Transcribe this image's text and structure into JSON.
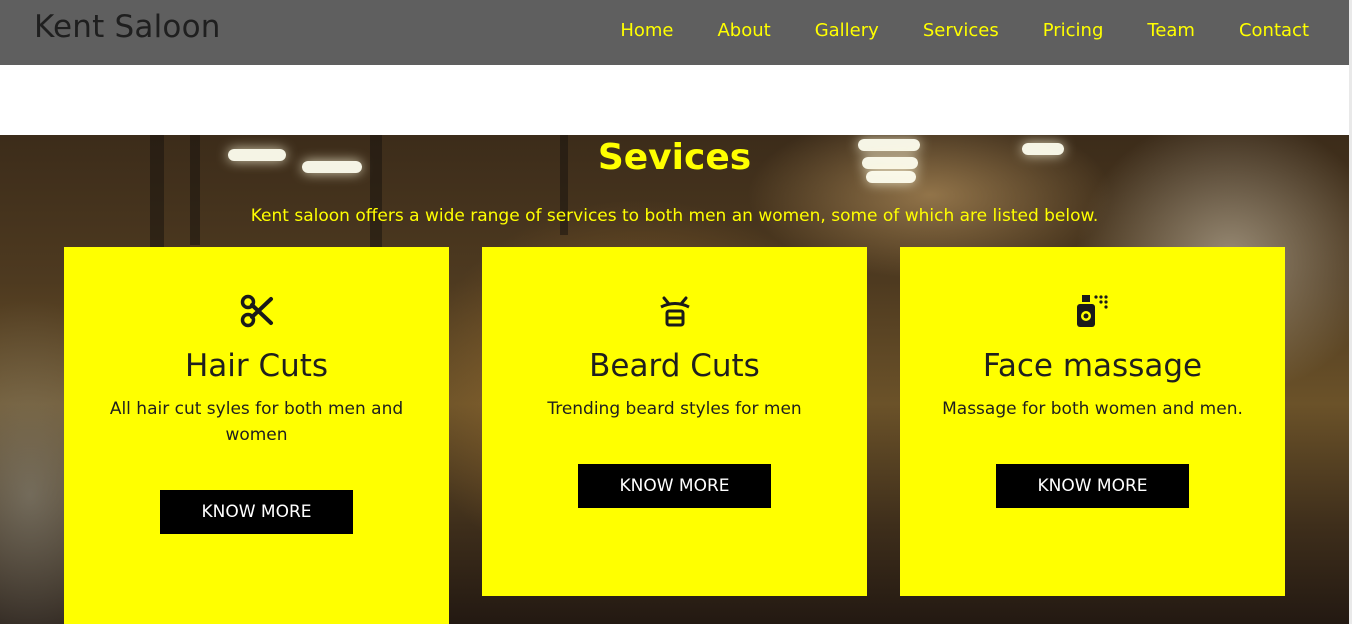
{
  "brand": "Kent Saloon",
  "nav": [
    "Home",
    "About",
    "Gallery",
    "Services",
    "Pricing",
    "Team",
    "Contact"
  ],
  "services": {
    "title": "Sevices",
    "subtitle": "Kent saloon offers a wide range of services to both men an women, some of which are listed below.",
    "cards": [
      {
        "icon": "scissors-icon",
        "title": "Hair Cuts",
        "description": "All hair cut syles for both men and women",
        "button": "KNOW MORE"
      },
      {
        "icon": "beard-icon",
        "title": "Beard Cuts",
        "description": "Trending beard styles for men",
        "button": "KNOW MORE"
      },
      {
        "icon": "spray-bottle-icon",
        "title": "Face massage",
        "description": "Massage for both women and men.",
        "button": "KNOW MORE"
      }
    ]
  },
  "colors": {
    "accent": "#ffff00",
    "header": "#5f5f5f",
    "button": "#000000"
  }
}
